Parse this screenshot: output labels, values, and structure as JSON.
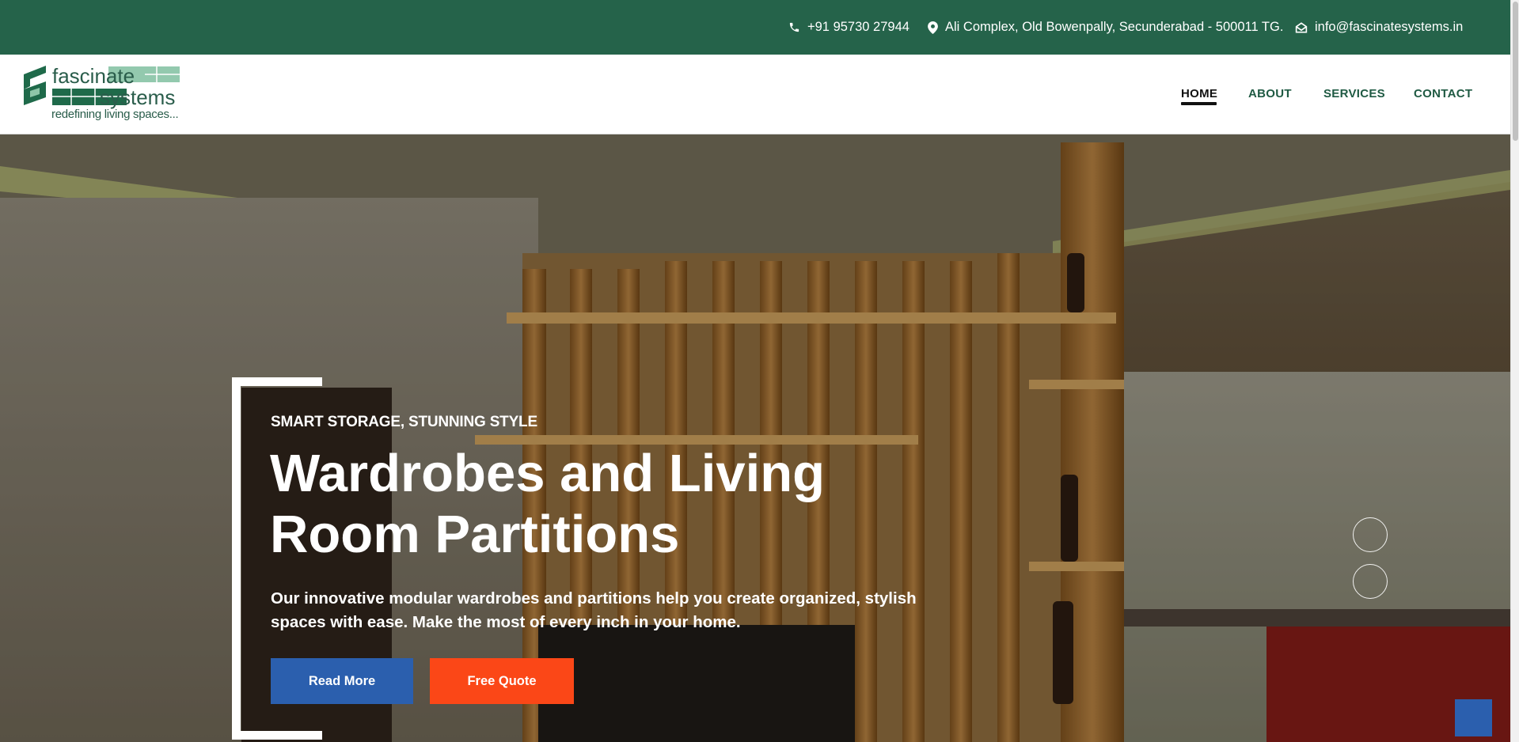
{
  "topbar": {
    "phone": "+91 95730 27944",
    "address": "Ali Complex, Old Bowenpally, Secunderabad - 500011 TG.",
    "email": "info@fascinatesystems.in",
    "icons": [
      "phone-icon",
      "map-pin-icon",
      "envelope-icon"
    ]
  },
  "logo": {
    "word1": "fascinate",
    "word2": "systems",
    "tagline": "redefining living spaces..."
  },
  "nav": {
    "items": [
      {
        "label": "HOME",
        "active": true
      },
      {
        "label": "ABOUT",
        "active": false
      },
      {
        "label": "SERVICES",
        "active": false
      },
      {
        "label": "CONTACT",
        "active": false
      }
    ]
  },
  "hero": {
    "eyebrow": "SMART STORAGE, STUNNING STYLE",
    "title": "Wardrobes and Living Room Partitions",
    "description": "Our innovative modular wardrobes and partitions help you create organized, stylish spaces with ease. Make the most of every inch in your home.",
    "read_more_label": "Read More",
    "free_quote_label": "Free Quote"
  },
  "colors": {
    "brand_green": "#25634a",
    "primary_blue": "#2b5fae",
    "accent_orange": "#fb4717"
  }
}
